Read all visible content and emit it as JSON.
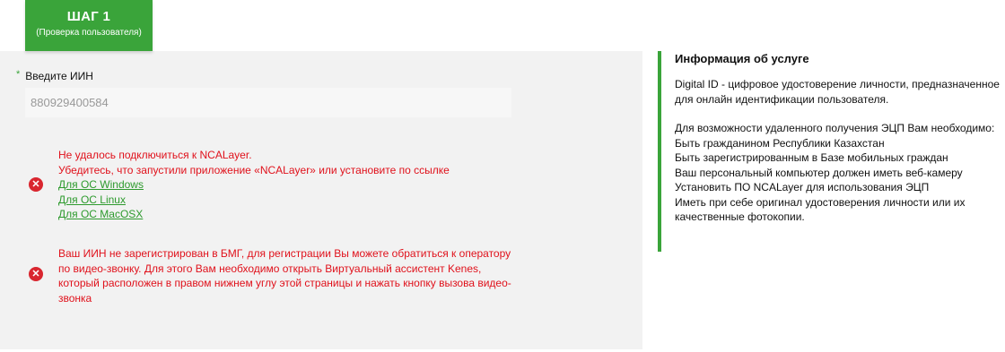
{
  "step": {
    "title": "ШАГ 1",
    "subtitle": "(Проверка пользователя)"
  },
  "form": {
    "iin_label": "Введите ИИН",
    "required_mark": "*",
    "iin_value": "880929400584"
  },
  "errors": {
    "ncalayer": {
      "line1": "Не удалось подключиться к NCALayer.",
      "line2": "Убедитесь, что запустили приложение «NCALayer» или установите по ссылке",
      "link_windows": "Для ОС Windows",
      "link_linux": "Для ОС Linux",
      "link_macos": "Для ОС MacOSX"
    },
    "bmg": {
      "line1": "Ваш ИИН не зарегистрирован в БМГ, для регистрации Вы можете обратиться к оператору",
      "line2": "по видео-звонку.  Для этого Вам необходимо открыть Виртуальный ассистент Kenes,",
      "line3": "который расположен в правом нижнем углу этой страницы и нажать кнопку вызова видео-",
      "line4": "звонка"
    }
  },
  "info": {
    "title": "Информация об услуге",
    "p1_line1": "Digital ID - цифровое удостоверение личности, предназначенное",
    "p1_line2": "для онлайн идентификации пользователя.",
    "req_line0": "Для возможности удаленного получения ЭЦП Вам необходимо:",
    "req_line1": "Быть гражданином Республики Казахстан",
    "req_line2": "Быть зарегистрированным в Базе мобильных граждан",
    "req_line3": "Ваш персональный компьютер должен иметь веб-камеру",
    "req_line4": "Установить ПО NCALayer для использования ЭЦП",
    "req_line5": "Иметь при себе оригинал удостоверения личности или их",
    "req_line6": "качественные фотокопии."
  },
  "colors": {
    "accent": "#3aa43a",
    "error": "#e0111b",
    "link": "#2d9a2d",
    "panel": "#f2f2f2"
  },
  "icons": {
    "error": "error-x-icon"
  }
}
